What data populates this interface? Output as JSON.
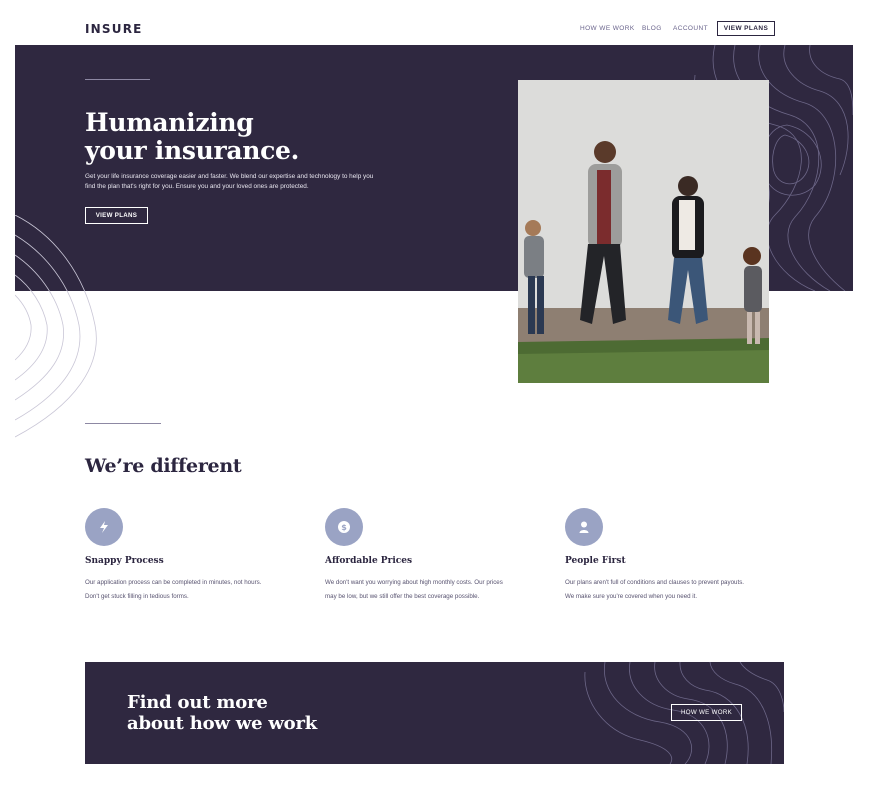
{
  "header": {
    "logo": "INSURE",
    "nav": [
      "HOW WE WORK",
      "BLOG",
      "ACCOUNT"
    ],
    "cta": "VIEW PLANS"
  },
  "hero": {
    "title_line1": "Humanizing",
    "title_line2": "your insurance.",
    "text_line1": "Get your life insurance coverage easier and faster. We blend our expertise and technology to help you",
    "text_line2": "find the plan that's right for you. Ensure you and your loved ones are protected.",
    "button": "VIEW PLANS"
  },
  "different": {
    "title": "We’re different",
    "features": [
      {
        "icon": "lightning-icon",
        "title": "Snappy Process",
        "line1": "Our application process can be completed in minutes, not hours.",
        "line2": "Don't get stuck filling in tedious forms."
      },
      {
        "icon": "dollar-icon",
        "title": "Affordable Prices",
        "line1": "We don't want you worrying about high monthly costs. Our prices",
        "line2": "may be low, but we still offer the best coverage possible."
      },
      {
        "icon": "person-icon",
        "title": "People First",
        "line1": "Our plans aren't full of conditions and clauses to prevent payouts.",
        "line2": "We make sure you're covered when you need it."
      }
    ]
  },
  "cta": {
    "title_line1": "Find out more",
    "title_line2": "about how we work",
    "button": "HOW WE WORK"
  },
  "colors": {
    "dark_violet": "#2f2840",
    "grayish_violet": "#6a648c",
    "icon_blue": "#9aa3c4"
  }
}
